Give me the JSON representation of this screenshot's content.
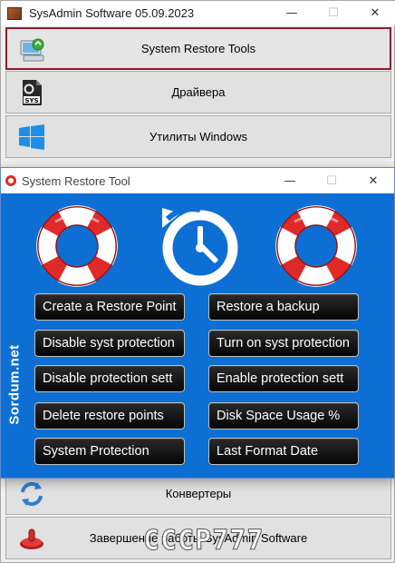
{
  "main_window": {
    "title": "SysAdmin Software 05.09.2023",
    "controls": {
      "minimize": "—",
      "maximize": "☐",
      "close": "✕"
    },
    "menu": [
      {
        "label": "System Restore Tools",
        "icon": "computer-restore-icon",
        "active": true
      },
      {
        "label": "Драйвера",
        "icon": "sys-file-icon"
      },
      {
        "label": "Утилиты Windows",
        "icon": "windows-logo-icon"
      },
      {
        "label": "Конвертеры",
        "icon": "convert-arrows-icon"
      },
      {
        "label": "Завершение работы SysAdmin Software",
        "icon": "shutdown-icon"
      }
    ]
  },
  "restore_tool": {
    "title": "System Restore Tool",
    "controls": {
      "minimize": "—",
      "maximize": "☐",
      "close": "✕"
    },
    "side_label": "Sordum.net",
    "buttons": {
      "left": [
        "Create a Restore Point",
        "Disable syst protection",
        "Disable protection sett",
        "Delete restore points",
        "System Protection"
      ],
      "right": [
        "Restore a backup",
        "Turn on syst protection",
        "Enable protection sett",
        "Disk Space Usage %",
        "Last Format Date"
      ]
    }
  },
  "watermark": "CCCP777",
  "colors": {
    "accent": "#0d6fd3",
    "active_border": "#8e1a2f",
    "buoy_red": "#e02a2a"
  }
}
